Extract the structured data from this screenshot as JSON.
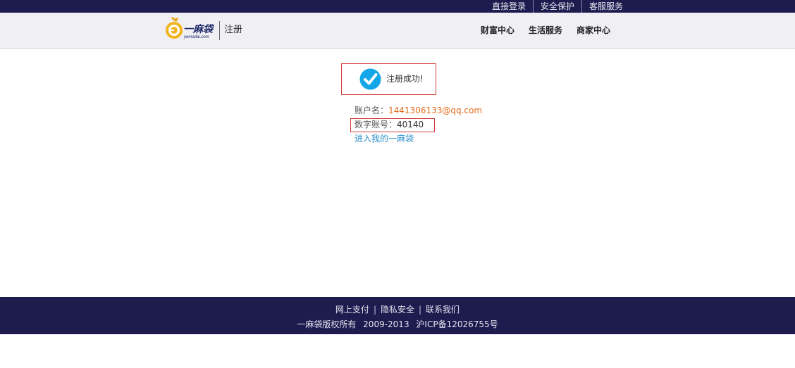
{
  "topbar": {
    "links": [
      "直接登录",
      "安全保护",
      "客服服务"
    ]
  },
  "header": {
    "logo_text": "一麻袋",
    "logo_domain": "yemadai.com",
    "logo_icon": "bag-logo-icon",
    "page_label": "注册",
    "nav": [
      "财富中心",
      "生活服务",
      "商家中心"
    ]
  },
  "success": {
    "icon": "check-circle-icon",
    "icon_color": "#13a6e8",
    "message": "注册成功!"
  },
  "account": {
    "name_label": "账户名：",
    "name_value": "1441306133@qq.com",
    "number_label": "数字账号：",
    "number_value": "40140",
    "enter_link": "进入我的一麻袋"
  },
  "footer": {
    "links": [
      "网上支付",
      "隐私安全",
      "联系我们"
    ],
    "separator": "|",
    "copyright": "一麻袋版权所有",
    "years": "2009-2013",
    "icp": "沪ICP备12026755号"
  },
  "colors": {
    "nav_dark": "#1e1b4f",
    "header_bg": "#efeff4",
    "highlight_border": "#d43c3c",
    "account_orange": "#e46a1c",
    "link_blue": "#2a8fcc"
  }
}
